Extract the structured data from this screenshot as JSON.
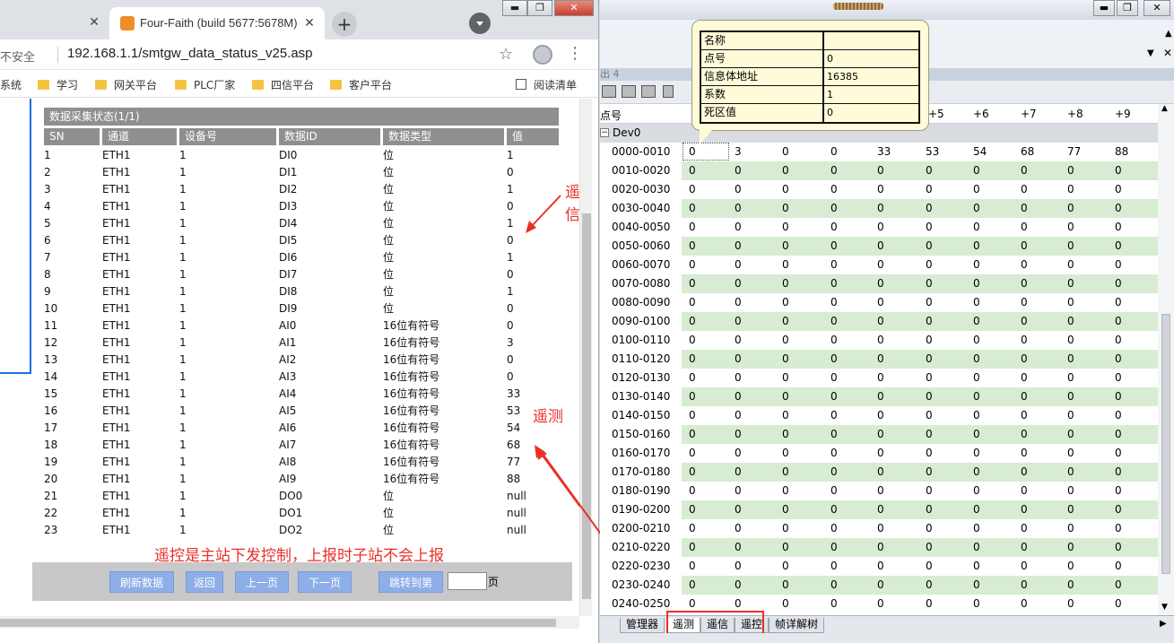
{
  "browser": {
    "tabs": [
      {
        "title": ""
      },
      {
        "title": "Four-Faith (build 5677:5678M)"
      }
    ],
    "security_label": "不安全",
    "url": "192.168.1.1/smtgw_data_status_v25.asp",
    "bookmarks": [
      "系统",
      "学习",
      "网关平台",
      "PLC厂家",
      "四信平台",
      "客户平台"
    ],
    "reading_list": "阅读清单"
  },
  "page": {
    "section_title": "数据采集状态(1/1)",
    "columns": [
      "SN",
      "通道",
      "设备号",
      "数据ID",
      "数据类型",
      "值"
    ],
    "rows": [
      [
        "1",
        "ETH1",
        "1",
        "DI0",
        "位",
        "1"
      ],
      [
        "2",
        "ETH1",
        "1",
        "DI1",
        "位",
        "0"
      ],
      [
        "3",
        "ETH1",
        "1",
        "DI2",
        "位",
        "1"
      ],
      [
        "4",
        "ETH1",
        "1",
        "DI3",
        "位",
        "0"
      ],
      [
        "5",
        "ETH1",
        "1",
        "DI4",
        "位",
        "1"
      ],
      [
        "6",
        "ETH1",
        "1",
        "DI5",
        "位",
        "0"
      ],
      [
        "7",
        "ETH1",
        "1",
        "DI6",
        "位",
        "1"
      ],
      [
        "8",
        "ETH1",
        "1",
        "DI7",
        "位",
        "0"
      ],
      [
        "9",
        "ETH1",
        "1",
        "DI8",
        "位",
        "1"
      ],
      [
        "10",
        "ETH1",
        "1",
        "DI9",
        "位",
        "0"
      ],
      [
        "11",
        "ETH1",
        "1",
        "AI0",
        "16位有符号",
        "0"
      ],
      [
        "12",
        "ETH1",
        "1",
        "AI1",
        "16位有符号",
        "3"
      ],
      [
        "13",
        "ETH1",
        "1",
        "AI2",
        "16位有符号",
        "0"
      ],
      [
        "14",
        "ETH1",
        "1",
        "AI3",
        "16位有符号",
        "0"
      ],
      [
        "15",
        "ETH1",
        "1",
        "AI4",
        "16位有符号",
        "33"
      ],
      [
        "16",
        "ETH1",
        "1",
        "AI5",
        "16位有符号",
        "53"
      ],
      [
        "17",
        "ETH1",
        "1",
        "AI6",
        "16位有符号",
        "54"
      ],
      [
        "18",
        "ETH1",
        "1",
        "AI7",
        "16位有符号",
        "68"
      ],
      [
        "19",
        "ETH1",
        "1",
        "AI8",
        "16位有符号",
        "77"
      ],
      [
        "20",
        "ETH1",
        "1",
        "AI9",
        "16位有符号",
        "88"
      ],
      [
        "21",
        "ETH1",
        "1",
        "DO0",
        "位",
        "null"
      ],
      [
        "22",
        "ETH1",
        "1",
        "DO1",
        "位",
        "null"
      ],
      [
        "23",
        "ETH1",
        "1",
        "DO2",
        "位",
        "null"
      ]
    ],
    "annotations": {
      "yaoxin": "遥信",
      "yaoce": "遥测",
      "yaokong": "遥控是主站下发控制，上报时子站不会上报"
    },
    "buttons": {
      "refresh": "刷新数据",
      "back": "返回",
      "prev": "上一页",
      "next": "下一页",
      "goto": "跳转到第"
    },
    "page_input": "",
    "page_suffix": "页"
  },
  "app": {
    "pane_title": "出 4",
    "grid_headers": [
      "点号",
      "+5",
      "+6",
      "+7",
      "+8",
      "+9"
    ],
    "device": "Dev0",
    "row_labels": [
      "0000-0010",
      "0010-0020",
      "0020-0030",
      "0030-0040",
      "0040-0050",
      "0050-0060",
      "0060-0070",
      "0070-0080",
      "0080-0090",
      "0090-0100",
      "0100-0110",
      "0110-0120",
      "0120-0130",
      "0130-0140",
      "0140-0150",
      "0150-0160",
      "0160-0170",
      "0170-0180",
      "0180-0190",
      "0190-0200",
      "0200-0210",
      "0210-0220",
      "0220-0230",
      "0230-0240",
      "0240-0250"
    ],
    "first_row_values": [
      "0",
      "3",
      "0",
      "0",
      "33",
      "53",
      "54",
      "68",
      "77",
      "88"
    ],
    "default_value": "0",
    "bottom_tabs": [
      "管理器",
      "遥测",
      "遥信",
      "遥控",
      "帧详解树"
    ],
    "tooltip": [
      {
        "k": "名称",
        "v": ""
      },
      {
        "k": "点号",
        "v": "0"
      },
      {
        "k": "信息体地址",
        "v": "16385"
      },
      {
        "k": "系数",
        "v": "1"
      },
      {
        "k": "死区值",
        "v": "0"
      }
    ]
  },
  "colors": {
    "alt_row": "#d7ecd2",
    "annotation": "#e8302a",
    "header_gray": "#8f8f8f",
    "button_blue": "#8eaee8"
  }
}
